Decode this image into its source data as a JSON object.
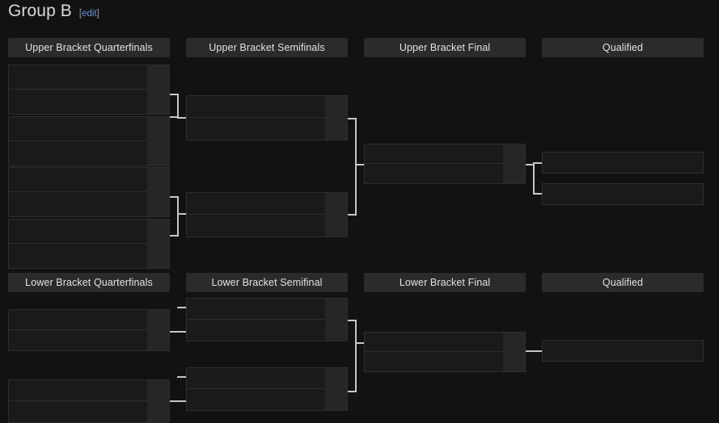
{
  "page": {
    "title": "Group B",
    "edit_label": "edit",
    "bracket_open": "[",
    "bracket_close": "]"
  },
  "theme": {
    "background": "#121212",
    "header_background": "#2b2b2b",
    "match_background": "#1a1a1a",
    "score_background": "#262626",
    "border": "#2e2e2e",
    "connector": "#c6c6c6",
    "text": "#e2e2e2",
    "link": "#6b93d6"
  },
  "upper_bracket": {
    "headers": [
      {
        "label": "Upper Bracket Quarterfinals"
      },
      {
        "label": "Upper Bracket Semifinals"
      },
      {
        "label": "Upper Bracket Final"
      },
      {
        "label": "Qualified"
      }
    ],
    "quarterfinals": [
      {
        "team1": "",
        "team2": "",
        "score1": "",
        "score2": ""
      },
      {
        "team1": "",
        "team2": "",
        "score1": "",
        "score2": ""
      },
      {
        "team1": "",
        "team2": "",
        "score1": "",
        "score2": ""
      },
      {
        "team1": "",
        "team2": "",
        "score1": "",
        "score2": ""
      }
    ],
    "semifinals": [
      {
        "team1": "",
        "team2": "",
        "score1": "",
        "score2": ""
      },
      {
        "team1": "",
        "team2": "",
        "score1": "",
        "score2": ""
      }
    ],
    "final": [
      {
        "team1": "",
        "team2": "",
        "score1": "",
        "score2": ""
      }
    ],
    "qualified": [
      {
        "team": ""
      },
      {
        "team": ""
      }
    ]
  },
  "lower_bracket": {
    "headers": [
      {
        "label": "Lower Bracket Quarterfinals"
      },
      {
        "label": "Lower Bracket Semifinal"
      },
      {
        "label": "Lower Bracket Final"
      },
      {
        "label": "Qualified"
      }
    ],
    "quarterfinals": [
      {
        "team1": "",
        "team2": "",
        "score1": "",
        "score2": ""
      },
      {
        "team1": "",
        "team2": "",
        "score1": "",
        "score2": ""
      }
    ],
    "semifinals": [
      {
        "team1": "",
        "team2": "",
        "score1": "",
        "score2": ""
      },
      {
        "team1": "",
        "team2": "",
        "score1": "",
        "score2": ""
      }
    ],
    "final": [
      {
        "team1": "",
        "team2": "",
        "score1": "",
        "score2": ""
      }
    ],
    "qualified": [
      {
        "team": ""
      }
    ]
  }
}
